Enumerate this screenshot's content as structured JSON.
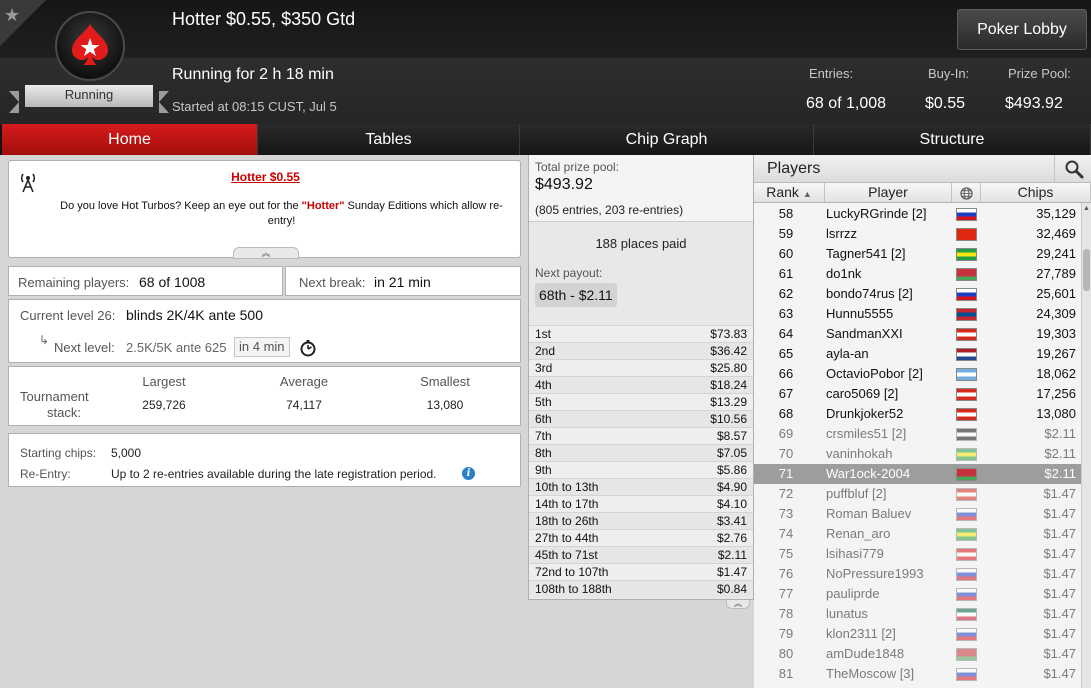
{
  "header": {
    "status": "Running",
    "title": "Hotter $0.55, $350 Gtd",
    "running_for": "Running for 2 h 18 min",
    "started": "Started at 08:15 CUST, Jul 5",
    "lobby_button": "Poker Lobby",
    "entries_label": "Entries:",
    "entries_value": "68 of 1,008",
    "buyin_label": "Buy-In:",
    "buyin_value": "$0.55",
    "prize_label": "Prize Pool:",
    "prize_value": "$493.92"
  },
  "tabs": [
    "Home",
    "Tables",
    "Chip Graph",
    "Structure"
  ],
  "promo": {
    "title": "Hotter $0.55",
    "text_before": "Do you love Hot Turbos? Keep an eye out for the ",
    "text_hot": "\"Hotter\"",
    "text_after": " Sunday Editions which allow re-entry!",
    "collapse_icon": "double-chevron-up"
  },
  "remaining": {
    "label": "Remaining players:",
    "value": "68 of 1008"
  },
  "next_break": {
    "label": "Next break:",
    "value": "in 21 min"
  },
  "level": {
    "current_label": "Current level 26:",
    "current_value": "blinds 2K/4K ante 500",
    "next_label": "Next level:",
    "next_value": "2.5K/5K ante 625",
    "next_time": "in 4 min"
  },
  "stack": {
    "label_line1": "Tournament",
    "label_line2": "stack:",
    "largest_label": "Largest",
    "largest_value": "259,726",
    "average_label": "Average",
    "average_value": "74,117",
    "smallest_label": "Smallest",
    "smallest_value": "13,080"
  },
  "starting": {
    "chips_label": "Starting chips:",
    "chips_value": "5,000",
    "reentry_label": "Re-Entry:",
    "reentry_value": "Up to 2 re-entries available during the late registration period."
  },
  "prize": {
    "total_label": "Total prize pool:",
    "total_value": "$493.92",
    "entries_note": "(805 entries, 203 re-entries)",
    "places_paid": "188 places paid",
    "next_payout_label": "Next payout:",
    "next_payout_value": "68th - $2.11",
    "payouts": [
      {
        "place": "1st",
        "amount": "$73.83"
      },
      {
        "place": "2nd",
        "amount": "$36.42"
      },
      {
        "place": "3rd",
        "amount": "$25.80"
      },
      {
        "place": "4th",
        "amount": "$18.24"
      },
      {
        "place": "5th",
        "amount": "$13.29"
      },
      {
        "place": "6th",
        "amount": "$10.56"
      },
      {
        "place": "7th",
        "amount": "$8.57"
      },
      {
        "place": "8th",
        "amount": "$7.05"
      },
      {
        "place": "9th",
        "amount": "$5.86"
      },
      {
        "place": "10th to 13th",
        "amount": "$4.90"
      },
      {
        "place": "14th to 17th",
        "amount": "$4.10"
      },
      {
        "place": "18th to 26th",
        "amount": "$3.41"
      },
      {
        "place": "27th to 44th",
        "amount": "$2.76"
      },
      {
        "place": "45th to 71st",
        "amount": "$2.11"
      },
      {
        "place": "72nd to 107th",
        "amount": "$1.47"
      },
      {
        "place": "108th to 188th",
        "amount": "$0.84"
      }
    ]
  },
  "players": {
    "title": "Players",
    "search_icon": "magnifier",
    "col_rank": "Rank",
    "col_player": "Player",
    "col_globe": "globe",
    "col_chips": "Chips",
    "rows": [
      {
        "rank": "58",
        "name": "LuckyRGrinde [2]",
        "chips": "35,129",
        "flag": [
          "#ffffff",
          "#1c3fc4",
          "#d8141b"
        ],
        "out": false
      },
      {
        "rank": "59",
        "name": "lsrrzz",
        "chips": "32,469",
        "flag": [
          "#de2910",
          "#de2910",
          "#de2910"
        ],
        "out": false
      },
      {
        "rank": "60",
        "name": "Tagner541 [2]",
        "chips": "29,241",
        "flag": [
          "#229e45",
          "#f8e509",
          "#229e45"
        ],
        "out": false
      },
      {
        "rank": "61",
        "name": "do1nk",
        "chips": "27,789",
        "flag": [
          "#c8313e",
          "#c8313e",
          "#4aa657"
        ],
        "out": false
      },
      {
        "rank": "62",
        "name": "bondo74rus [2]",
        "chips": "25,601",
        "flag": [
          "#ffffff",
          "#1c3fc4",
          "#d8141b"
        ],
        "out": false
      },
      {
        "rank": "63",
        "name": "Hunnu5555",
        "chips": "24,309",
        "flag": [
          "#c4272f",
          "#015197",
          "#c4272f"
        ],
        "out": false
      },
      {
        "rank": "64",
        "name": "SandmanXXI",
        "chips": "19,303",
        "flag": [
          "#d52b1e",
          "#ffffff",
          "#d52b1e"
        ],
        "out": false
      },
      {
        "rank": "65",
        "name": "ayla-an",
        "chips": "19,267",
        "flag": [
          "#ae1c28",
          "#ffffff",
          "#21468b"
        ],
        "out": false
      },
      {
        "rank": "66",
        "name": "OctavioPobor [2]",
        "chips": "18,062",
        "flag": [
          "#74acdf",
          "#ffffff",
          "#74acdf"
        ],
        "out": false
      },
      {
        "rank": "67",
        "name": "caro5069 [2]",
        "chips": "17,256",
        "flag": [
          "#d52b1e",
          "#ffffff",
          "#d52b1e"
        ],
        "out": false
      },
      {
        "rank": "68",
        "name": "Drunkjoker52",
        "chips": "13,080",
        "flag": [
          "#d52b1e",
          "#ffffff",
          "#d52b1e"
        ],
        "out": false
      },
      {
        "rank": "69",
        "name": "crsmiles51 [2]",
        "chips": "$2.11",
        "flag": [
          "#111111",
          "#ffffff",
          "#111111"
        ],
        "out": true
      },
      {
        "rank": "70",
        "name": "vaninhokah",
        "chips": "$2.11",
        "flag": [
          "#229e45",
          "#f8e509",
          "#229e45"
        ],
        "out": true
      },
      {
        "rank": "71",
        "name": "War1ock-2004",
        "chips": "$2.11",
        "flag": [
          "#c8313e",
          "#c8313e",
          "#4aa657"
        ],
        "out": true,
        "highlight": true
      },
      {
        "rank": "72",
        "name": "puffbluf [2]",
        "chips": "$1.47",
        "flag": [
          "#d52b1e",
          "#ffffff",
          "#d52b1e"
        ],
        "out": true
      },
      {
        "rank": "73",
        "name": "Roman Baluev",
        "chips": "$1.47",
        "flag": [
          "#ffffff",
          "#1c3fc4",
          "#d8141b"
        ],
        "out": true
      },
      {
        "rank": "74",
        "name": "Renan_aro",
        "chips": "$1.47",
        "flag": [
          "#229e45",
          "#f8e509",
          "#229e45"
        ],
        "out": true
      },
      {
        "rank": "75",
        "name": "lsihasi779",
        "chips": "$1.47",
        "flag": [
          "#d8141b",
          "#ffffff",
          "#d8141b"
        ],
        "out": true
      },
      {
        "rank": "76",
        "name": "NoPressure1993",
        "chips": "$1.47",
        "flag": [
          "#ffffff",
          "#1c3fc4",
          "#d8141b"
        ],
        "out": true
      },
      {
        "rank": "77",
        "name": "pauliprde",
        "chips": "$1.47",
        "flag": [
          "#ffffff",
          "#1c3fc4",
          "#d8141b"
        ],
        "out": true
      },
      {
        "rank": "78",
        "name": "lunatus",
        "chips": "$1.47",
        "flag": [
          "#006847",
          "#ffffff",
          "#ce1126"
        ],
        "out": true
      },
      {
        "rank": "79",
        "name": "klon2311 [2]",
        "chips": "$1.47",
        "flag": [
          "#ffffff",
          "#1c3fc4",
          "#d8141b"
        ],
        "out": true
      },
      {
        "rank": "80",
        "name": "amDude1848",
        "chips": "$1.47",
        "flag": [
          "#c8313e",
          "#c8313e",
          "#4aa657"
        ],
        "out": true
      },
      {
        "rank": "81",
        "name": "TheMoscow [3]",
        "chips": "$1.47",
        "flag": [
          "#ffffff",
          "#1c3fc4",
          "#d8141b"
        ],
        "out": true
      }
    ]
  },
  "colors": {
    "accent_red": "#cc0000",
    "active_tab": "#c41414",
    "highlight_row": "#9d9d9d",
    "eliminated_text": "#7a7a7a"
  }
}
